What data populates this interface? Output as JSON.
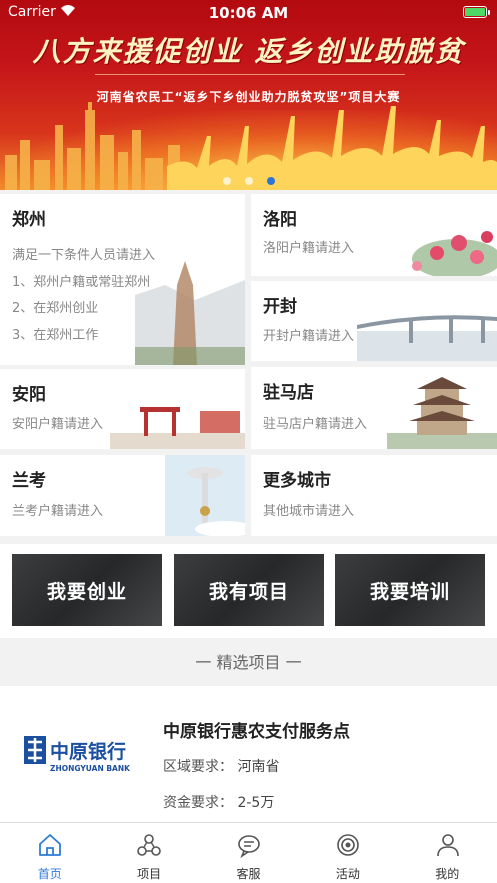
{
  "status_bar": {
    "carrier": "Carrier",
    "time": "10:06 AM"
  },
  "banner": {
    "title": "八方来援促创业 返乡创业助脱贫",
    "subtitle": "河南省农民工“返乡下乡创业助力脱贫攻坚”项目大赛",
    "slides": 3,
    "active_slide": 3
  },
  "cities": {
    "zhengzhou": {
      "name": "郑州",
      "lines": [
        "满足一下条件人员请进入",
        "1、郑州户籍或常驻郑州",
        "2、在郑州创业",
        "3、在郑州工作"
      ]
    },
    "luoyang": {
      "name": "洛阳",
      "desc": "洛阳户籍请进入"
    },
    "kaifeng": {
      "name": "开封",
      "desc": "开封户籍请进入"
    },
    "anyang": {
      "name": "安阳",
      "desc": "安阳户籍请进入"
    },
    "zhumadian": {
      "name": "驻马店",
      "desc": "驻马店户籍请进入"
    },
    "lankao": {
      "name": "兰考",
      "desc": "兰考户籍请进入"
    },
    "more": {
      "name": "更多城市",
      "desc": "其他城市请进入"
    }
  },
  "actions": [
    "我要创业",
    "我有项目",
    "我要培训"
  ],
  "section": {
    "title": "一 精选项目 一"
  },
  "project": {
    "logo_text": "中原银行",
    "logo_en": "ZHONGYUAN BANK",
    "title": "中原银行惠农支付服务点",
    "region_label": "区域要求：",
    "region_value": "河南省",
    "fund_label": "资金要求：",
    "fund_value": "2-5万"
  },
  "tabs": [
    {
      "label": "首页",
      "icon": "home-icon",
      "active": true
    },
    {
      "label": "项目",
      "icon": "project-icon",
      "active": false
    },
    {
      "label": "客服",
      "icon": "chat-icon",
      "active": false
    },
    {
      "label": "活动",
      "icon": "activity-icon",
      "active": false
    },
    {
      "label": "我的",
      "icon": "user-icon",
      "active": false
    }
  ],
  "colors": {
    "accent": "#2f7bd6",
    "banner_red": "#c5161a",
    "bank_blue": "#1b4fa0"
  }
}
